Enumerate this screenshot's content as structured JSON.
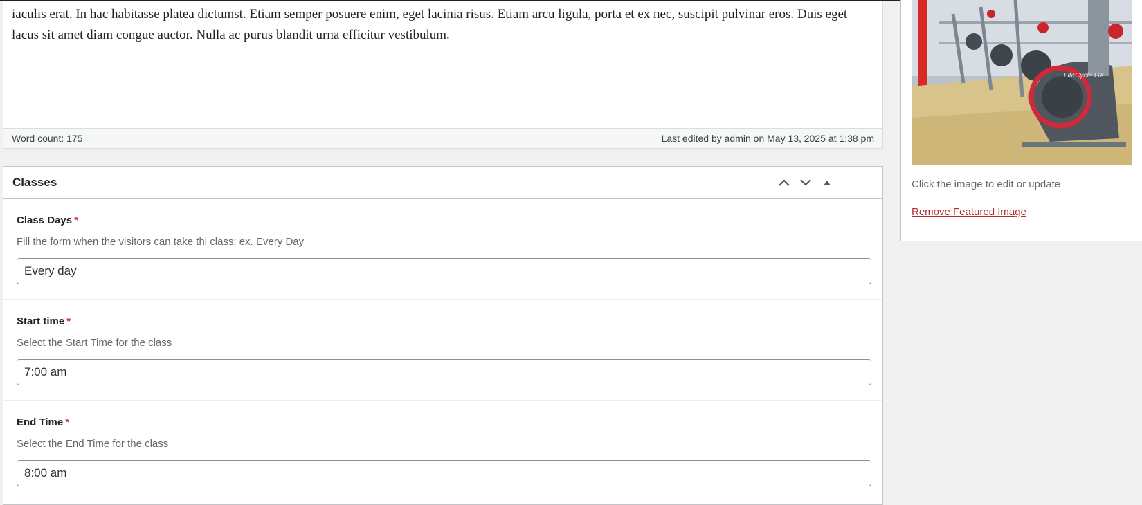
{
  "editor": {
    "body_text": "iaculis erat. In hac habitasse platea dictumst. Etiam semper posuere enim, eget lacinia risus. Etiam arcu ligula, porta et ex nec, suscipit pulvinar eros. Duis eget lacus sit amet diam congue auctor. Nulla ac purus blandit urna efficitur vestibulum.",
    "word_count": "Word count: 175",
    "last_edited": "Last edited by admin on May 13, 2025 at 1:38 pm"
  },
  "metabox": {
    "title": "Classes",
    "controls": [
      "move-up",
      "move-down",
      "toggle-panel"
    ],
    "fields": [
      {
        "label": "Class Days",
        "required": "*",
        "description": "Fill the form when the visitors can take thi class: ex. Every Day",
        "value": "Every day"
      },
      {
        "label": "Start time",
        "required": "*",
        "description": "Select the Start Time for the class",
        "value": "7:00 am"
      },
      {
        "label": "End Time",
        "required": "*",
        "description": "Select the End Time for the class",
        "value": "8:00 am"
      }
    ]
  },
  "featured_image": {
    "hint": "Click the image to edit or update",
    "remove_label": "Remove Featured Image",
    "image_brand_text": "LifeCycle GX"
  },
  "colors": {
    "required": "#d63638",
    "link_danger": "#b32d2e",
    "background": "#f0f0f1"
  }
}
